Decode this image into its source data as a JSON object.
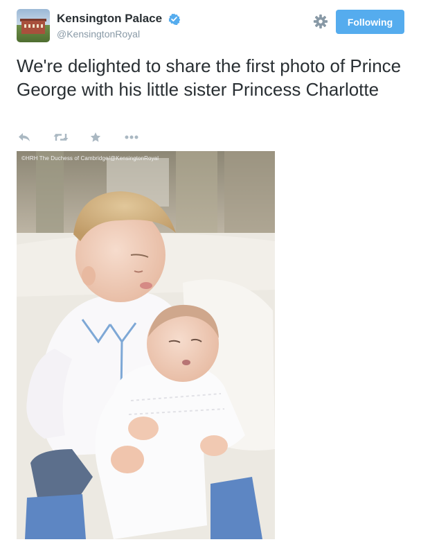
{
  "header": {
    "name": "Kensington Palace",
    "handle": "@KensingtonRoyal",
    "follow_label": "Following"
  },
  "tweet": {
    "text": "We're delighted to share the first photo of Prince George with his little sister Princess Charlotte"
  },
  "actions": [
    {
      "icon": "reply-icon"
    },
    {
      "icon": "retweet-icon"
    },
    {
      "icon": "favorite-star-icon"
    },
    {
      "icon": "more-options-icon"
    }
  ],
  "photo": {
    "credit": "©HRH The Duchess of Cambridge/@KensingtonRoyal"
  },
  "colors": {
    "accent": "#55acee",
    "muted": "#8899a6",
    "text": "#292f33",
    "action_icon": "#aab8c2"
  }
}
